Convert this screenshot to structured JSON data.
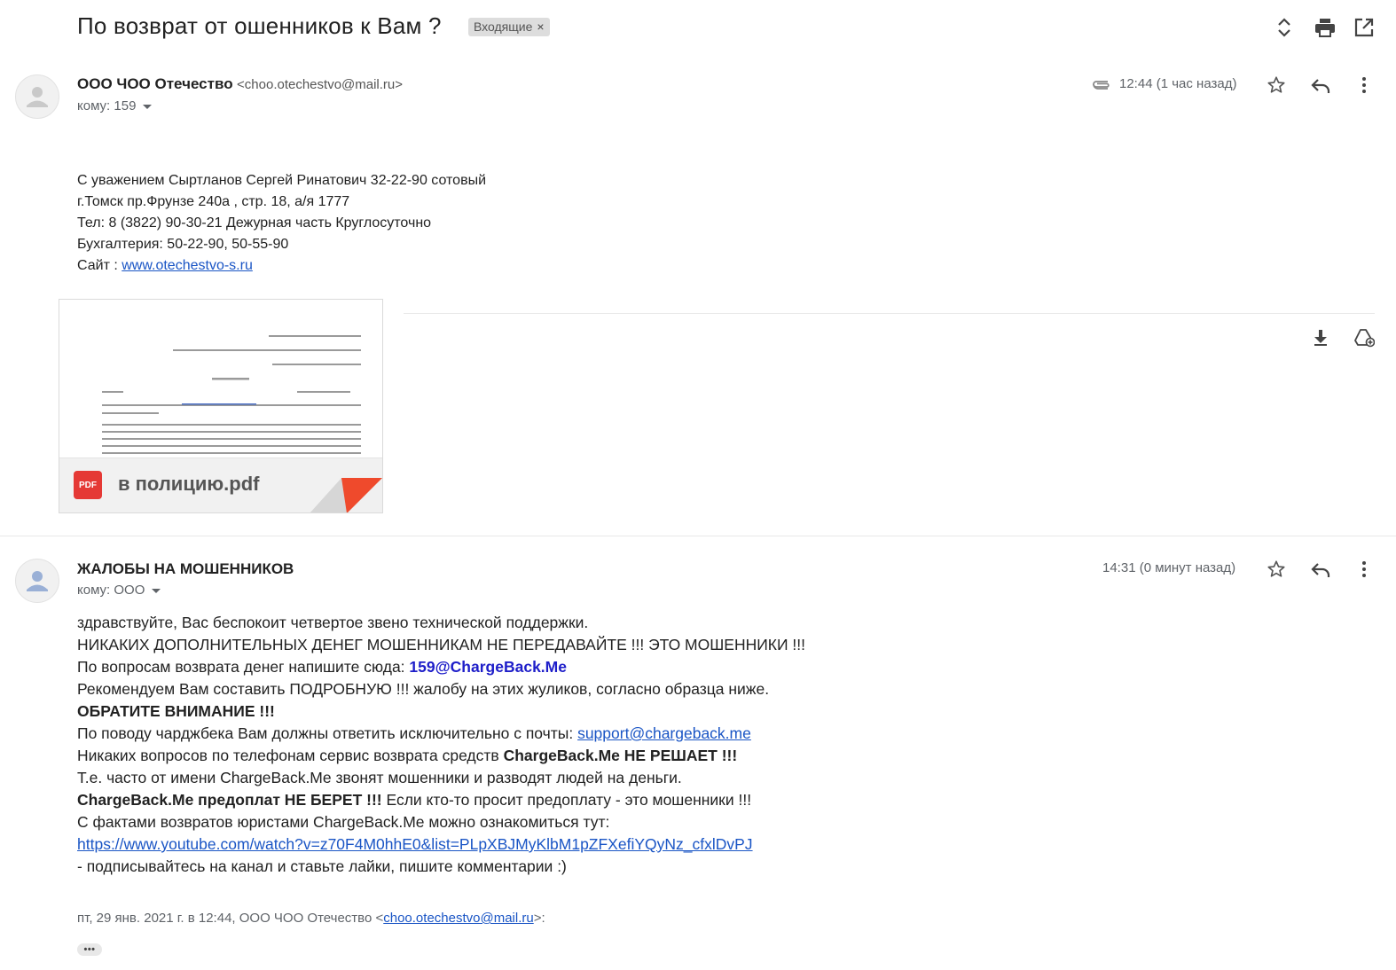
{
  "thread": {
    "subject": "По возврат от ошенников к Вам ?",
    "label": "Входящие",
    "label_remove": "×"
  },
  "message1": {
    "sender_name": "ООО ЧОО Отечество",
    "sender_email": "<choo.otechestvo@mail.ru>",
    "to": "кому: 159",
    "time": "12:44 (1 час назад)",
    "signature": [
      "С уважением Сыртланов Сергей Ринатович 32-22-90 сотовый",
      "г.Томск пр.Фрунзе 240а , стр. 18, а/я 1777",
      "Тел: 8 (3822) 90-30-21 Дежурная часть Круглосуточно",
      "Бухгалтерия: 50-22-90, 50-55-90"
    ],
    "site_label": "Сайт : ",
    "site_link": "www.otechestvo-s.ru",
    "attachment": {
      "badge": "PDF",
      "filename": "в полицию.pdf"
    }
  },
  "message2": {
    "sender_name": "ЖАЛОБЫ НА МОШЕННИКОВ",
    "to": "кому: ООО",
    "time": "14:31 (0 минут назад)",
    "l1": "здравствуйте, Вас беспокоит четвертое звено технической поддержки.",
    "l2": "НИКАКИХ ДОПОЛНИТЕЛЬНЫХ ДЕНЕГ МОШЕННИКАМ НЕ ПЕРЕДАВАЙТЕ !!! ЭТО МОШЕННИКИ !!!",
    "l3_text": "По вопросам возврата денег напишите сюда: ",
    "l3_email": "159@ChargeBack.Me",
    "l4": "Рекомендуем Вам составить ПОДРОБНУЮ !!! жалобу на этих жуликов, согласно образца ниже.",
    "l5": "ОБРАТИТЕ ВНИМАНИЕ !!!",
    "l6_text": "По поводу чарджбека Вам должны ответить исключительно с почты: ",
    "l6_link": "support@chargeback.me",
    "l7_text": "Никаких вопросов по телефонам сервис возврата средств ",
    "l7_bold": "ChargeBack.Me НЕ РЕШАЕТ !!!",
    "l8": "Т.е. часто от имени ChargeBack.Me звонят мошенники и разводят людей на деньги.",
    "l9_bold": "ChargeBack.Me предоплат НЕ БЕРЕТ !!!",
    "l9_text": " Если кто-то просит предоплату - это мошенники !!!",
    "l10": "С фактами возвратов юристами ChargeBack.Me можно ознакомиться тут:",
    "l11_link": "https://www.youtube.com/watch?v=z70F4M0hhE0&list=PLpXBJMyKlbM1pZFXefiYQyNz_cfxlDvPJ",
    "l12": " - подписывайтесь на канал и ставьте лайки, пишите комментарии :)",
    "quote_prefix": "пт, 29 янв. 2021 г. в 12:44, ООО ЧОО Отечество <",
    "quote_email": "choo.otechestvo@mail.ru",
    "quote_suffix": ">:",
    "ellipsis": "•••"
  },
  "icons": {
    "expand": "expand-collapse-icon",
    "print": "print-icon",
    "new_window": "open-in-new-window-icon",
    "attachment": "paperclip-icon",
    "star": "star-icon",
    "reply": "reply-icon",
    "more": "more-vertical-icon",
    "download": "download-icon",
    "drive": "add-to-drive-icon"
  }
}
